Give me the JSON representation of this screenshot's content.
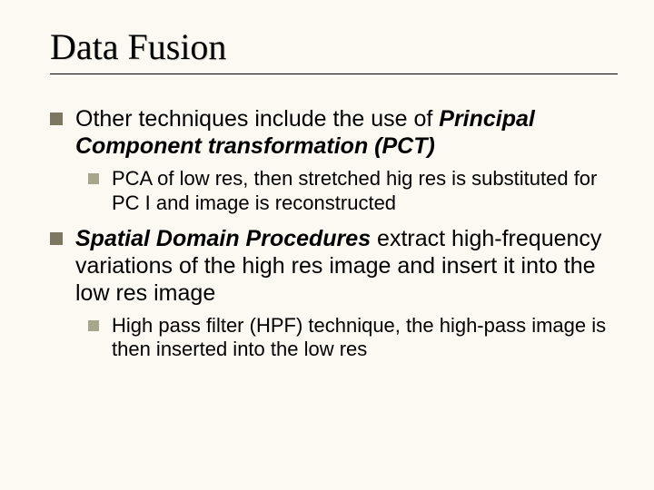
{
  "title": "Data Fusion",
  "bullets": [
    {
      "prefix": "Other techniques include the use of ",
      "bold": "Principal Component transformation (PCT)",
      "suffix": "",
      "sub": [
        {
          "text": "PCA of low res, then stretched hig res is substituted for PC I and image is reconstructed"
        }
      ]
    },
    {
      "prefix": "",
      "bold": "Spatial Domain Procedures",
      "suffix": " extract high-frequency variations of the high res image and insert it into the low res image",
      "sub": [
        {
          "text": "High pass filter (HPF) technique, the high-pass image is then inserted into the low res"
        }
      ]
    }
  ]
}
